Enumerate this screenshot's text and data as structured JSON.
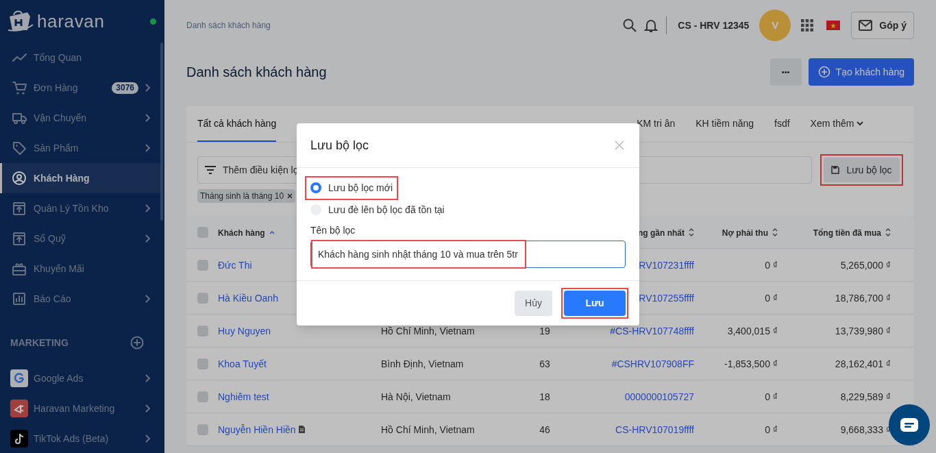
{
  "sidebar": {
    "brand": "haravan",
    "online": true,
    "items": [
      {
        "label": "Tổng Quan",
        "submenu": false,
        "selected": false
      },
      {
        "label": "Đơn Hàng",
        "badge": "3076",
        "submenu": true,
        "selected": false
      },
      {
        "label": "Vận Chuyển",
        "submenu": true,
        "selected": false
      },
      {
        "label": "Sản Phẩm",
        "submenu": true,
        "selected": false
      },
      {
        "label": "Khách Hàng",
        "submenu": false,
        "selected": true
      },
      {
        "label": "Quản Lý Tồn Kho",
        "submenu": true,
        "selected": false
      },
      {
        "label": "Số Quỹ",
        "submenu": true,
        "selected": false
      },
      {
        "label": "Khuyến Mãi",
        "submenu": false,
        "selected": false
      },
      {
        "label": "Báo Cáo",
        "submenu": true,
        "selected": false
      }
    ],
    "section": "MARKETING",
    "apps": [
      {
        "label": "Google Ads",
        "submenu": true
      },
      {
        "label": "Haravan Marketing",
        "submenu": true
      },
      {
        "label": "TikTok Ads (Beta)",
        "submenu": true
      }
    ]
  },
  "topbar": {
    "breadcrumb": "Danh sách khách hàng",
    "store": "CS - HRV 12345",
    "avatar": "V",
    "feedback": "Góp ý"
  },
  "page": {
    "title": "Danh sách khách hàng",
    "more": "•••",
    "create": "Tạo khách hàng"
  },
  "tabs": [
    {
      "label": "Tất cả khách hàng",
      "selected": true
    },
    {
      "label": "KM tri ân",
      "selected": false
    },
    {
      "label": "KH tiềm năng",
      "selected": false
    },
    {
      "label": "fsdf",
      "selected": false
    },
    {
      "label": "Xem thêm",
      "selected": false,
      "dropdown": true
    }
  ],
  "filter": {
    "placeholder": "Thêm điều kiện lọ",
    "save": "Lưu bộ lọc",
    "save_highlighted": true,
    "chips": [
      "Tháng sinh là tháng 10"
    ]
  },
  "table": {
    "all_checked": false,
    "columns": [
      {
        "label": "Khách hàng",
        "sorted": true
      },
      {},
      {},
      {
        "label": "ng gần nhất",
        "sorted": false
      },
      {
        "label": "Nợ phải thu",
        "sorted": false
      },
      {
        "label": "Tổng tiền đã mua",
        "sorted": false
      }
    ],
    "rows": [
      {
        "name": "Đức Thi",
        "code": "RV107231ffff",
        "debt": "0 ₫",
        "total": "5,265,000 ₫",
        "note": false,
        "checked": false
      },
      {
        "name": "Hà Kiều Oanh",
        "code": "RV107255ffff",
        "debt": "0 ₫",
        "total": "18,786,700 ₫",
        "note": false,
        "checked": false
      },
      {
        "name": "Huy Nguyen",
        "address": "Hồ Chí Minh, Vietnam",
        "orders": "19",
        "code": "#CS-HRV107748ffff",
        "debt": "3,400,015 ₫",
        "total": "13,739,980 ₫",
        "note": false,
        "checked": false
      },
      {
        "name": "Khoa Tuyết",
        "address": "Bình Định, Vietnam",
        "orders": "63",
        "code": "#CSHRV107908FF",
        "debt": "-1,853,500 ₫",
        "total": "28,162,401 ₫",
        "note": false,
        "checked": false
      },
      {
        "name": "Nghiêm test",
        "address": "Hà Nội, Vietnam",
        "orders": "18",
        "code": "0000000105727",
        "debt": "0 ₫",
        "total": "8,229,589 ₫",
        "note": false,
        "checked": false
      },
      {
        "name": "Nguyễn Hiền Hiền",
        "address": "Hồ Chí Minh, Vietnam",
        "orders": "46",
        "code": "CS-HRV107019ffff",
        "debt": "0 ₫",
        "total": "9,668,333 ₫",
        "note": true,
        "checked": false
      }
    ]
  },
  "dialog": {
    "title": "Lưu bộ lọc",
    "options": [
      {
        "label": "Lưu bộ lọc mới",
        "selected": true,
        "highlighted": true
      },
      {
        "label": "Lưu đè lên bộ lọc đã tồn tại",
        "selected": false,
        "highlighted": false
      }
    ],
    "name_label": "Tên bộ lọc",
    "name_value": "Khách hàng sinh nhật tháng 10 và mua trên 5tr",
    "name_highlighted": true,
    "cancel": "Hủy",
    "save": "Lưu",
    "save_highlighted": true
  }
}
